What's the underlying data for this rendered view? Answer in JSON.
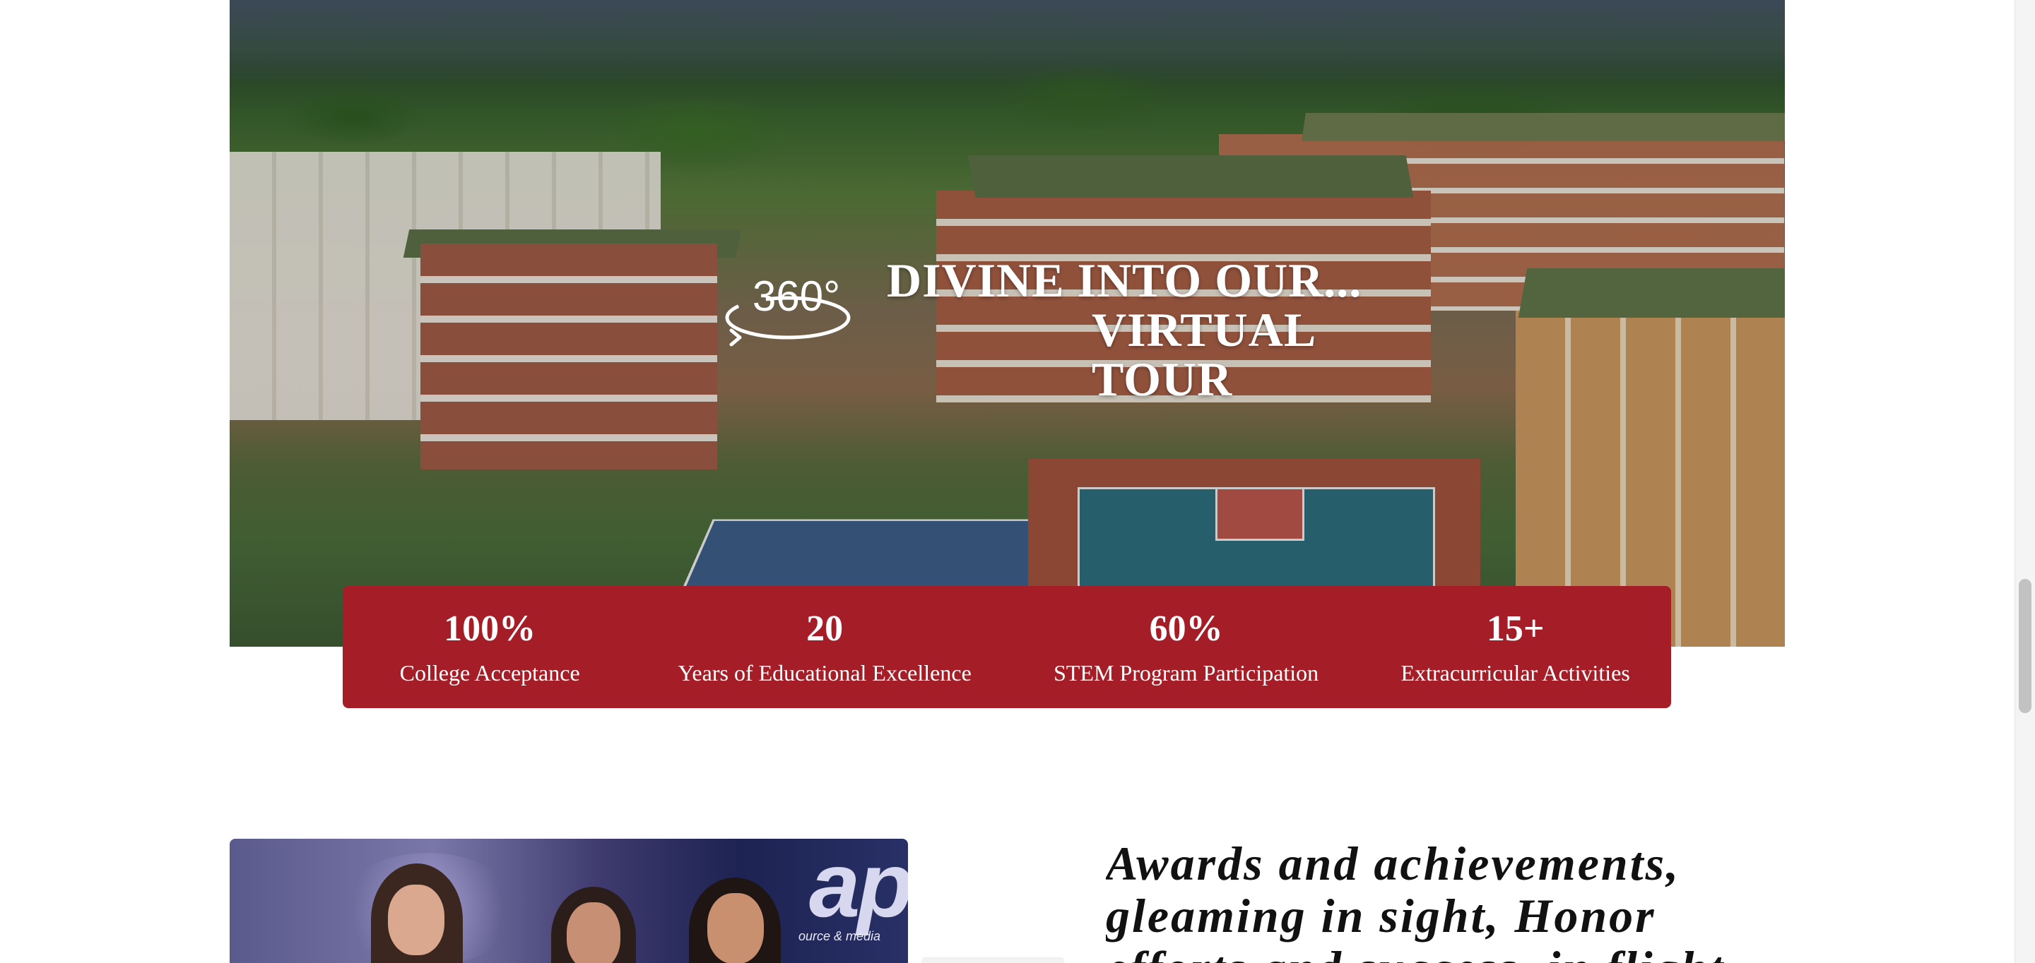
{
  "virtual_tour": {
    "title_line1": "DIVINE INTO OUR...",
    "title_line2": "VIRTUAL TOUR",
    "icon": "360-view-icon",
    "icon_text": "360°"
  },
  "stats": [
    {
      "value": "100%",
      "label": "College Acceptance"
    },
    {
      "value": "20",
      "label": "Years of Educational Excellence"
    },
    {
      "value": "60%",
      "label": "STEM Program Participation"
    },
    {
      "value": "15+",
      "label": "Extracurricular Activities"
    }
  ],
  "awards": {
    "heading": "Awards and achievements, gleaming in sight, Honor efforts and success, in flight.",
    "photo_logo_text": "aps",
    "photo_logo_subtext": "ource & media"
  },
  "colors": {
    "stats_background": "#a51d27",
    "text_on_stats": "#ffffff",
    "heading_text": "#111111"
  }
}
